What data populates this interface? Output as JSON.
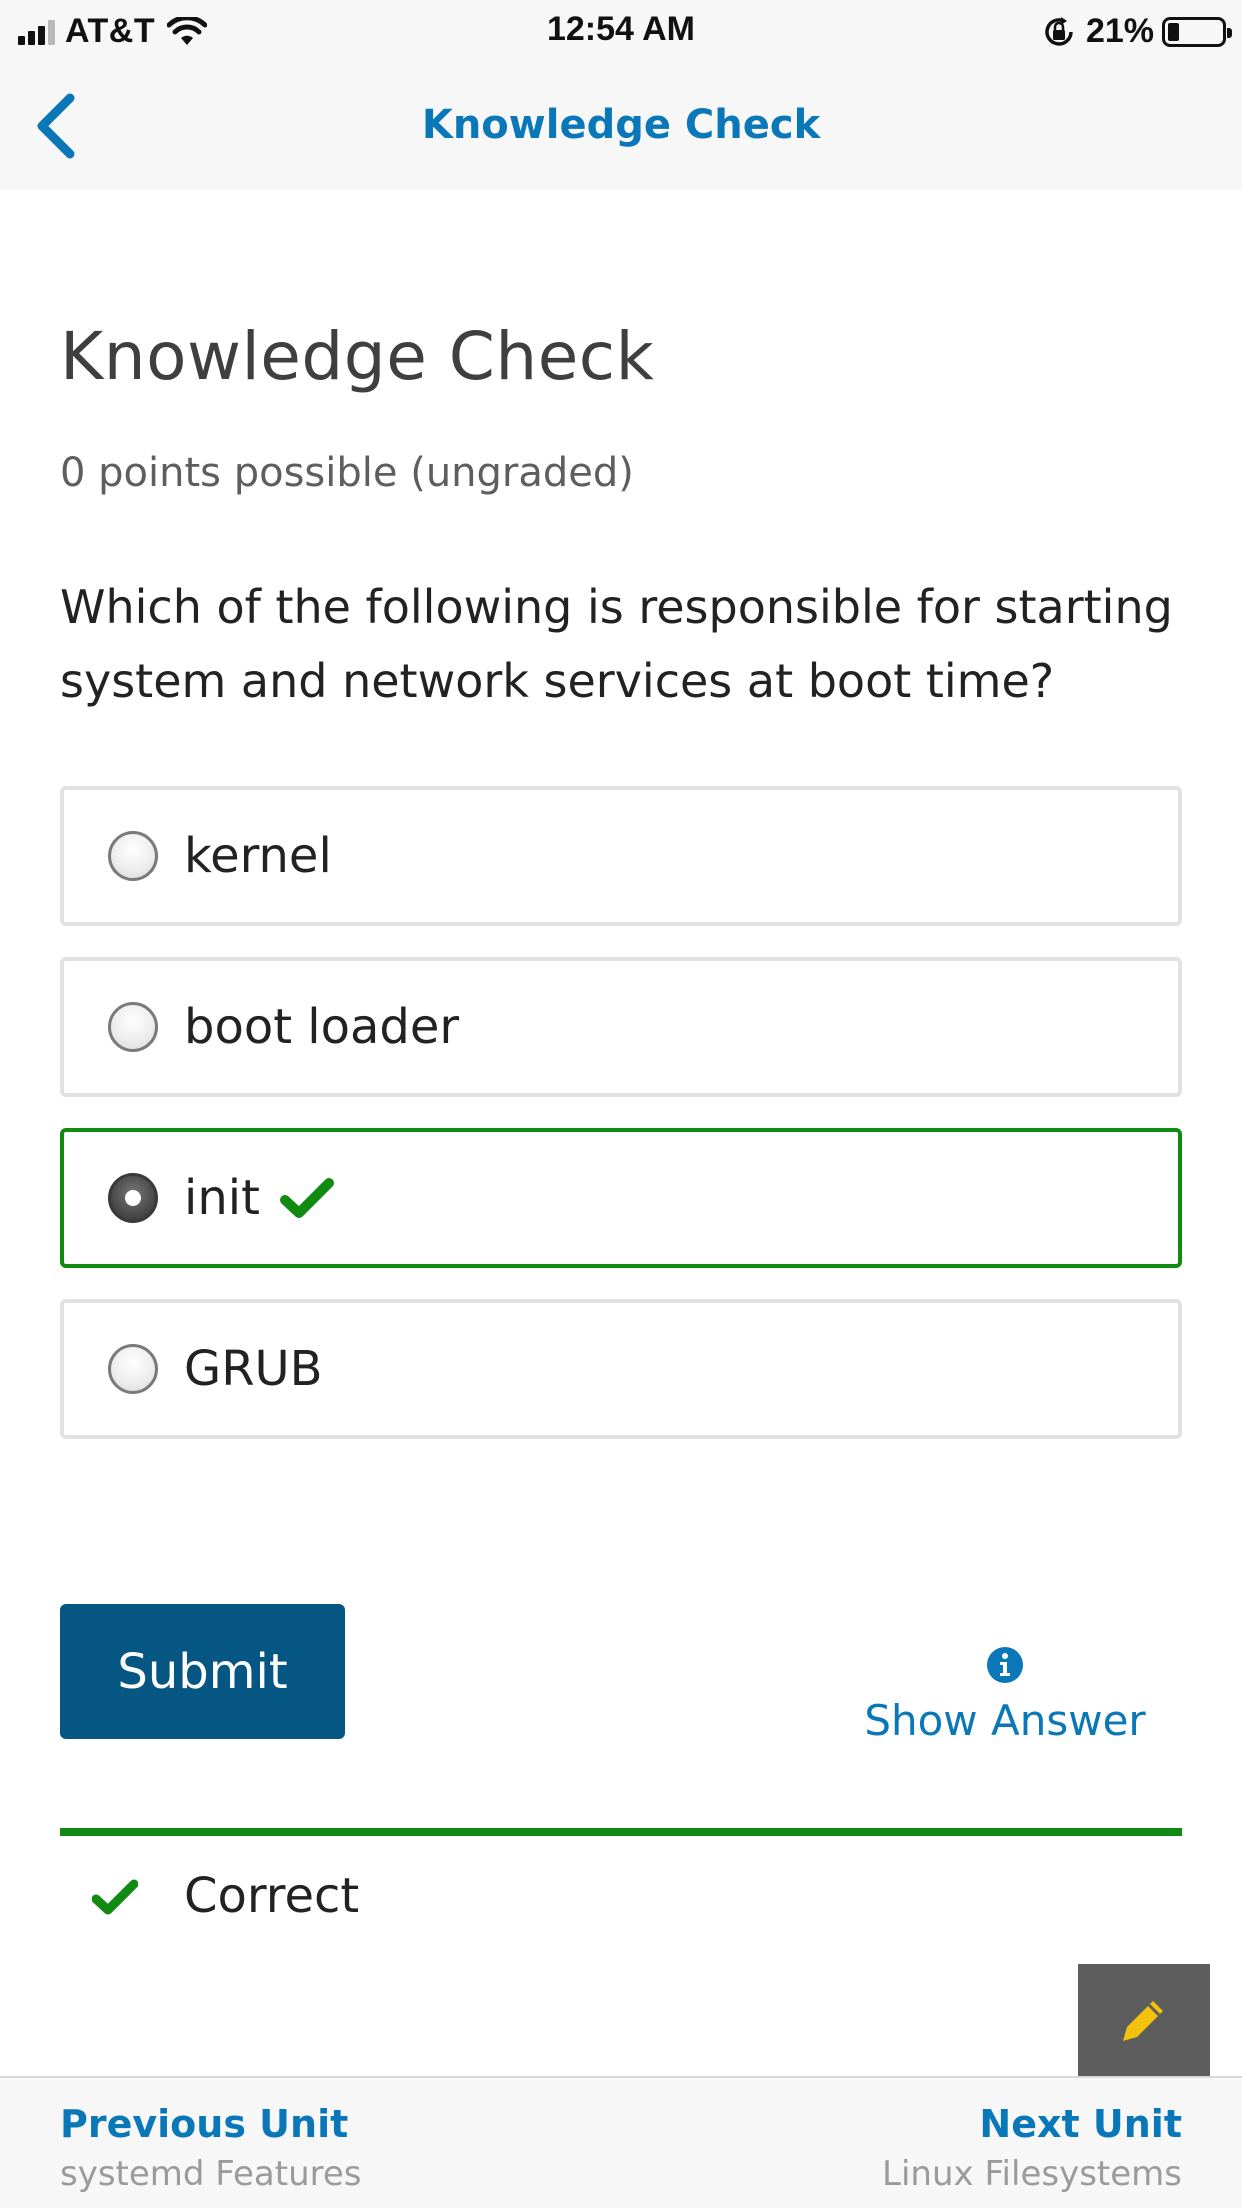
{
  "status_bar": {
    "carrier": "AT&T",
    "time": "12:54 AM",
    "battery_percent": "21%",
    "battery_level": 0.21,
    "icons": [
      "cellular-signal-icon",
      "wifi-icon",
      "orientation-lock-icon",
      "battery-icon"
    ]
  },
  "nav": {
    "title": "Knowledge Check",
    "back_icon": "chevron-left-icon"
  },
  "content": {
    "heading": "Knowledge Check",
    "points": "0 points possible (ungraded)",
    "question": "Which of the following is responsible for starting system and network services at boot time?",
    "options": [
      {
        "label": "kernel",
        "selected": false
      },
      {
        "label": "boot loader",
        "selected": false
      },
      {
        "label": "init",
        "selected": true,
        "correct": true
      },
      {
        "label": "GRUB",
        "selected": false
      }
    ],
    "submit_label": "Submit",
    "show_answer_label": "Show Answer",
    "result_label": "Correct"
  },
  "bottom_nav": {
    "previous": {
      "label": "Previous Unit",
      "title": "systemd Features"
    },
    "next": {
      "label": "Next Unit",
      "title": "Linux Filesystems"
    }
  },
  "colors": {
    "accent": "#0a77b8",
    "button": "#065683",
    "correct": "#118a11",
    "fab": "#5d5d5d",
    "pencil": "#f4c20d"
  }
}
